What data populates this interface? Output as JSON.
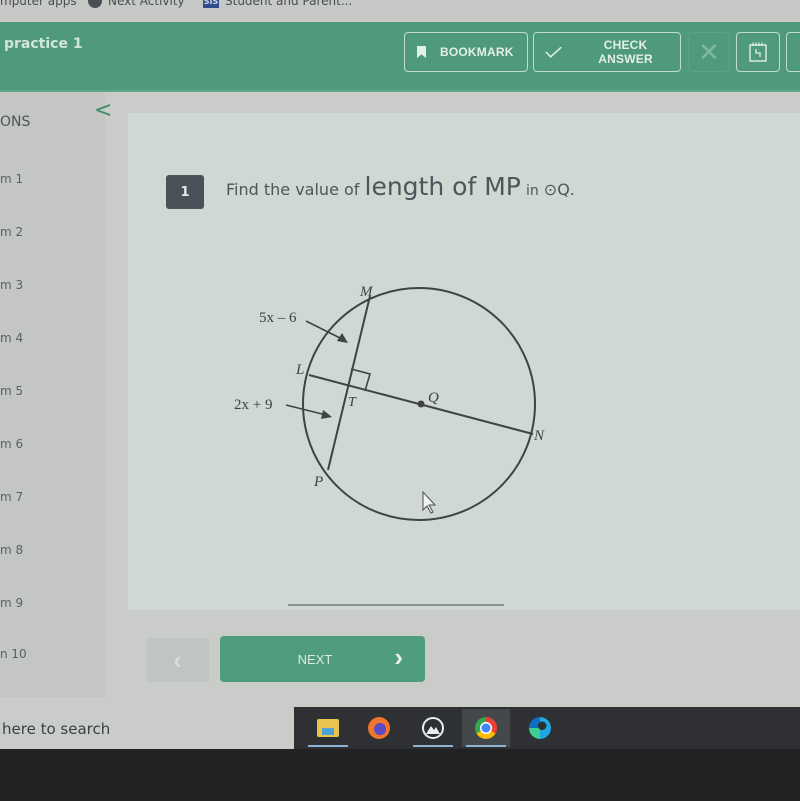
{
  "browser": {
    "bookmarks": [
      {
        "label": "mputer apps",
        "icon": "none"
      },
      {
        "label": "Next Activity",
        "icon": "globe-icon"
      },
      {
        "label": "Student and Parent...",
        "icon": "sis-icon",
        "badge": "SIS"
      }
    ]
  },
  "header": {
    "title": "practice 1",
    "bookmark_label": "BOOKMARK",
    "check_answer_label": "CHECK ANSWER",
    "close_glyph": "✕",
    "accent_color": "#4f9a7b"
  },
  "sidebar": {
    "title": "ONS",
    "collapse_glyph": "<",
    "items": [
      {
        "label": "m 1"
      },
      {
        "label": "m 2"
      },
      {
        "label": "m 3"
      },
      {
        "label": "m 4"
      },
      {
        "label": "m 5"
      },
      {
        "label": "m 6"
      },
      {
        "label": "m 7"
      },
      {
        "label": "m 8"
      },
      {
        "label": "m 9"
      },
      {
        "label": "n 10"
      }
    ]
  },
  "question": {
    "number": "1",
    "prefix": "Find the value of",
    "target": "length of MP",
    "in_text": "in",
    "circle_symbol": "⊙",
    "circle_name": "Q."
  },
  "diagram": {
    "points": {
      "M": "M",
      "L": "L",
      "T": "T",
      "Q": "Q",
      "N": "N",
      "P": "P"
    },
    "labels": {
      "upper_segment": "5x – 6",
      "lower_segment": "2x + 9"
    }
  },
  "navigation": {
    "prev_glyph": "‹",
    "next_label": "NEXT",
    "next_glyph": "›"
  },
  "taskbar": {
    "search_placeholder": "here to search",
    "apps": [
      {
        "name": "file-explorer",
        "running": true
      },
      {
        "name": "firefox",
        "running": false
      },
      {
        "name": "mountain-app",
        "running": true
      },
      {
        "name": "chrome",
        "running": true,
        "active": true
      },
      {
        "name": "edge",
        "running": false
      }
    ]
  }
}
